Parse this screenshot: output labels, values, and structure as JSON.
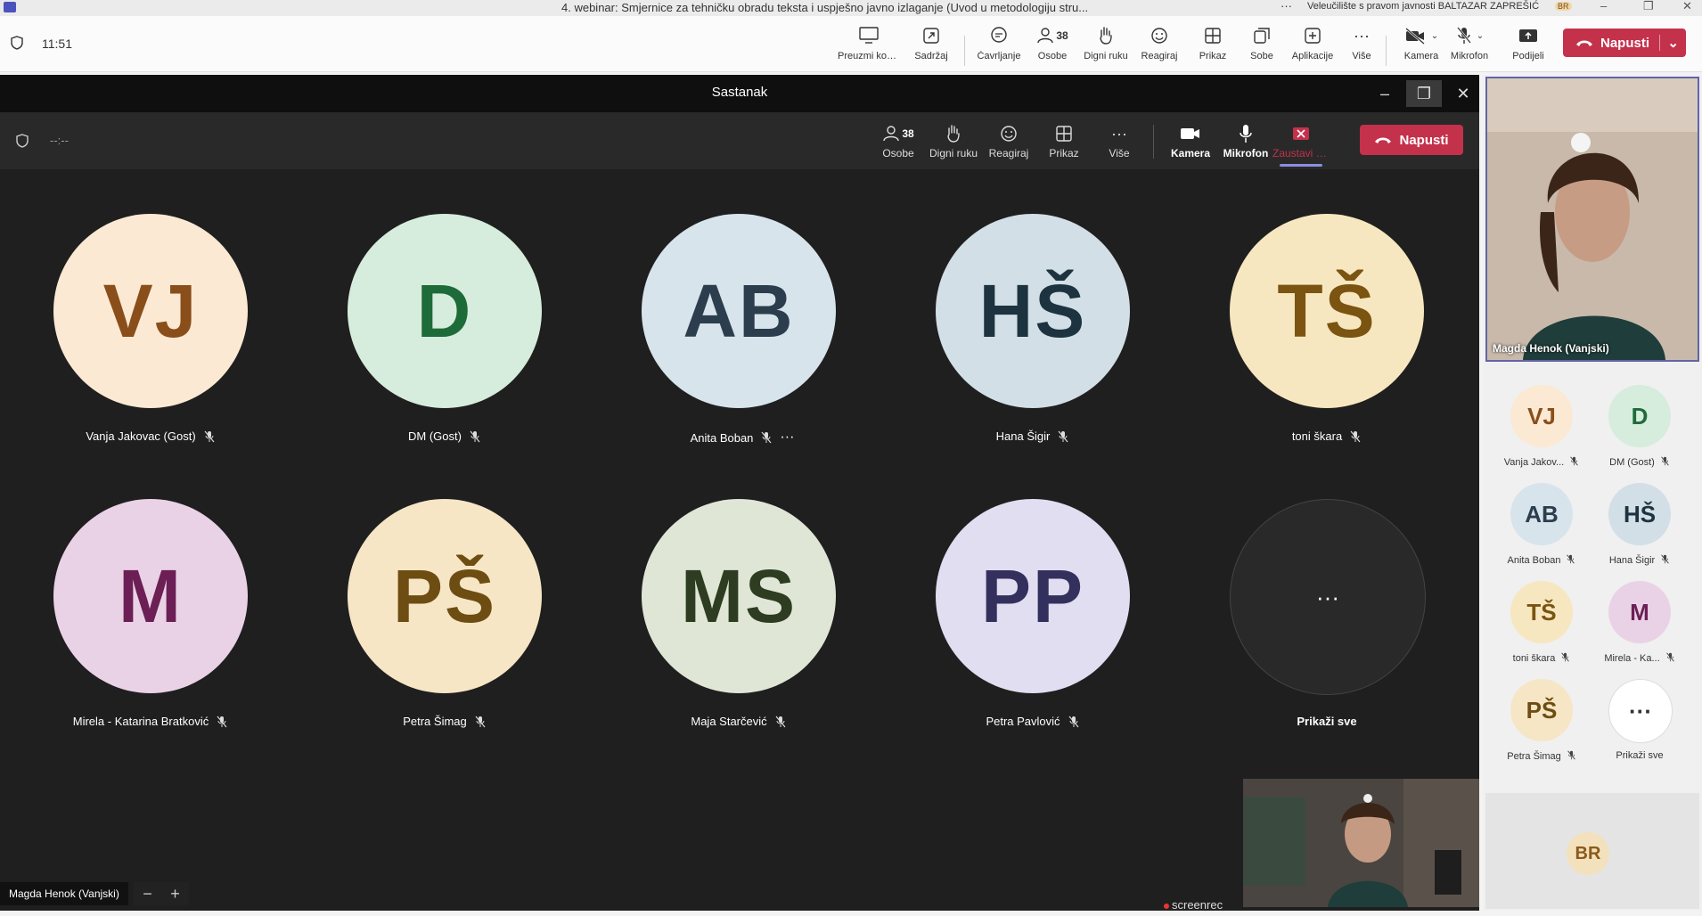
{
  "window": {
    "title": "4. webinar: Smjernice za tehničku obradu teksta i uspješno javno izlaganje (Uvod u metodologiju stru...",
    "org": "Veleučilište s pravom javnosti BALTAZAR ZAPREŠIĆ",
    "user_badge": "BR"
  },
  "main_toolbar": {
    "time": "11:51",
    "buttons": [
      {
        "label": "Preuzmi kon...",
        "icon": "share-screen-icon"
      },
      {
        "label": "Sadržaj",
        "icon": "content-icon"
      },
      {
        "label": "Čavrljanje",
        "icon": "chat-icon"
      },
      {
        "label": "Osobe",
        "icon": "people-icon",
        "count": "38"
      },
      {
        "label": "Digni ruku",
        "icon": "raise-hand-icon"
      },
      {
        "label": "Reagiraj",
        "icon": "react-icon"
      },
      {
        "label": "Prikaz",
        "icon": "view-icon"
      },
      {
        "label": "Sobe",
        "icon": "rooms-icon"
      },
      {
        "label": "Aplikacije",
        "icon": "apps-icon"
      },
      {
        "label": "Više",
        "icon": "more-icon"
      },
      {
        "label": "Kamera",
        "icon": "camera-off-icon"
      },
      {
        "label": "Mikrofon",
        "icon": "mic-off-icon"
      },
      {
        "label": "Podijeli",
        "icon": "share-icon"
      }
    ],
    "leave": "Napusti"
  },
  "meeting": {
    "title": "Sastanak",
    "time": "--:--",
    "buttons": [
      {
        "label": "Osobe",
        "count": "38"
      },
      {
        "label": "Digni ruku"
      },
      {
        "label": "Reagiraj"
      },
      {
        "label": "Prikaz"
      },
      {
        "label": "Više"
      },
      {
        "label": "Kamera"
      },
      {
        "label": "Mikrofon"
      },
      {
        "label": "Zaustavi zaj..."
      }
    ],
    "leave": "Napusti",
    "participants": [
      {
        "initials": "VJ",
        "name": "Vanja Jakovac (Gost)",
        "bg": "#fbe9d4",
        "fg": "#8a4e1a"
      },
      {
        "initials": "D",
        "name": "DM (Gost)",
        "bg": "#d6ecdc",
        "fg": "#1e6b3a"
      },
      {
        "initials": "AB",
        "name": "Anita Boban",
        "bg": "#d8e4ec",
        "fg": "#2c3e4e"
      },
      {
        "initials": "HŠ",
        "name": "Hana Šigir",
        "bg": "#d2dfe6",
        "fg": "#1e3340"
      },
      {
        "initials": "TŠ",
        "name": "toni škara",
        "bg": "#f7e7c0",
        "fg": "#7a5410"
      },
      {
        "initials": "M",
        "name": "Mirela - Katarina Bratković",
        "bg": "#ead2e6",
        "fg": "#6b1f55"
      },
      {
        "initials": "PŠ",
        "name": "Petra Šimag",
        "bg": "#f6e6c6",
        "fg": "#6e4d12"
      },
      {
        "initials": "MS",
        "name": "Maja Starčević",
        "bg": "#dfe6d6",
        "fg": "#2e3c22"
      },
      {
        "initials": "PP",
        "name": "Petra Pavlović",
        "bg": "#e0def0",
        "fg": "#34305e"
      }
    ],
    "show_all": "Prikaži sve",
    "self_label": "Magda Henok (Vanjski)",
    "watermark": "screenrec"
  },
  "right_panel": {
    "pinned_name": "Magda Henok (Vanjski)",
    "participants": [
      {
        "initials": "VJ",
        "name": "Vanja Jakov...",
        "bg": "#fbe9d4",
        "fg": "#8a4e1a"
      },
      {
        "initials": "D",
        "name": "DM (Gost)",
        "bg": "#d6ecdc",
        "fg": "#1e6b3a"
      },
      {
        "initials": "AB",
        "name": "Anita Boban",
        "bg": "#d8e4ec",
        "fg": "#2c3e4e"
      },
      {
        "initials": "HŠ",
        "name": "Hana Šigir",
        "bg": "#d2dfe6",
        "fg": "#1e3340"
      },
      {
        "initials": "TŠ",
        "name": "toni škara",
        "bg": "#f7e7c0",
        "fg": "#7a5410"
      },
      {
        "initials": "M",
        "name": "Mirela - Ka...",
        "bg": "#ead2e6",
        "fg": "#6b1f55"
      },
      {
        "initials": "PŠ",
        "name": "Petra Šimag",
        "bg": "#f6e6c6",
        "fg": "#6e4d12"
      }
    ],
    "show_all": "Prikaži sve",
    "self_initials": "BR"
  }
}
